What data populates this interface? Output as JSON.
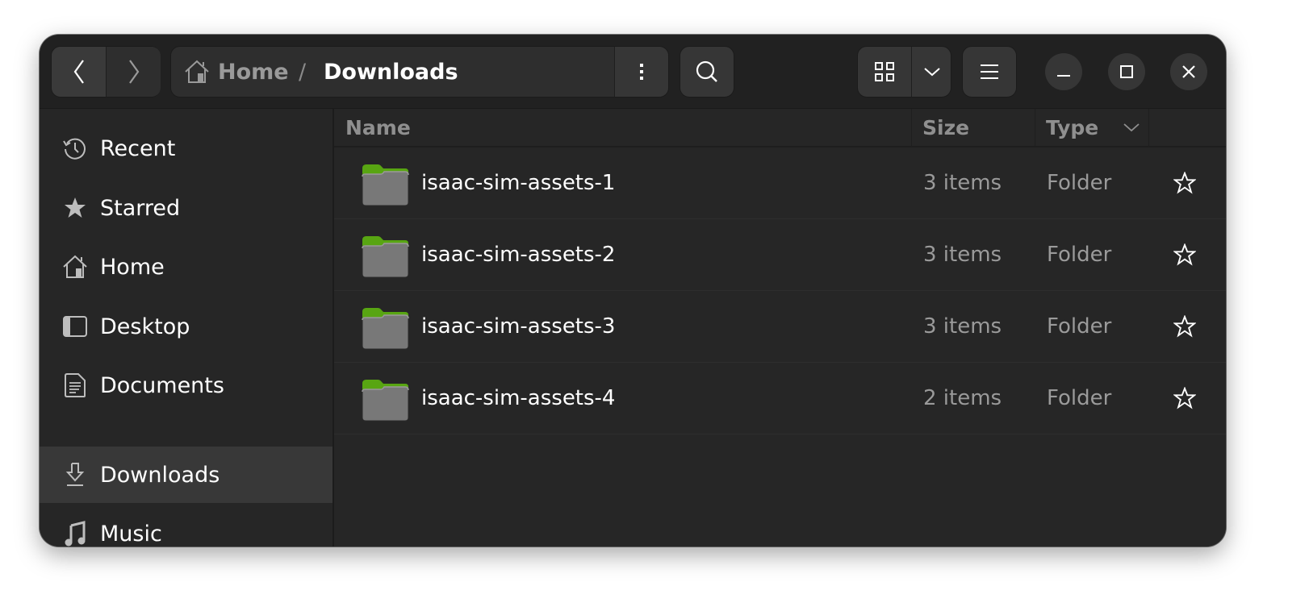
{
  "window": {
    "title": "Downloads"
  },
  "header": {
    "back_icon": "chevron-left-icon",
    "forward_icon": "chevron-right-icon",
    "breadcrumb": {
      "home_icon": "home-icon",
      "home_label": "Home",
      "separator": "/",
      "current": "Downloads"
    },
    "path_menu_icon": "vertical-dots-icon",
    "search_icon": "search-icon",
    "view_icon": "grid-view-icon",
    "view_dropdown_icon": "chevron-down-icon",
    "main_menu_icon": "hamburger-menu-icon",
    "minimize_icon": "minimize-icon",
    "maximize_icon": "maximize-icon",
    "close_icon": "close-icon"
  },
  "sidebar": {
    "items": [
      {
        "label": "Recent",
        "icon": "clock-icon",
        "selected": false
      },
      {
        "label": "Starred",
        "icon": "star-icon",
        "selected": false
      },
      {
        "label": "Home",
        "icon": "home-icon",
        "selected": false
      },
      {
        "label": "Desktop",
        "icon": "desktop-icon",
        "selected": false
      },
      {
        "label": "Documents",
        "icon": "document-icon",
        "selected": false
      },
      {
        "label": "Downloads",
        "icon": "download-icon",
        "selected": true
      },
      {
        "label": "Music",
        "icon": "music-note-icon",
        "selected": false
      }
    ]
  },
  "file_list": {
    "columns": {
      "name": "Name",
      "size": "Size",
      "type": "Type"
    },
    "sort_icon": "chevron-down-icon",
    "rows": [
      {
        "name": "isaac-sim-assets-1",
        "size": "3 items",
        "type": "Folder",
        "starred": false
      },
      {
        "name": "isaac-sim-assets-2",
        "size": "3 items",
        "type": "Folder",
        "starred": false
      },
      {
        "name": "isaac-sim-assets-3",
        "size": "3 items",
        "type": "Folder",
        "starred": false
      },
      {
        "name": "isaac-sim-assets-4",
        "size": "2 items",
        "type": "Folder",
        "starred": false
      }
    ]
  },
  "colors": {
    "folder_tab": "#4e9a06",
    "folder_body": "#787878",
    "selected_row": "#383838",
    "window_bg": "#262626",
    "header_bg": "#212121"
  }
}
